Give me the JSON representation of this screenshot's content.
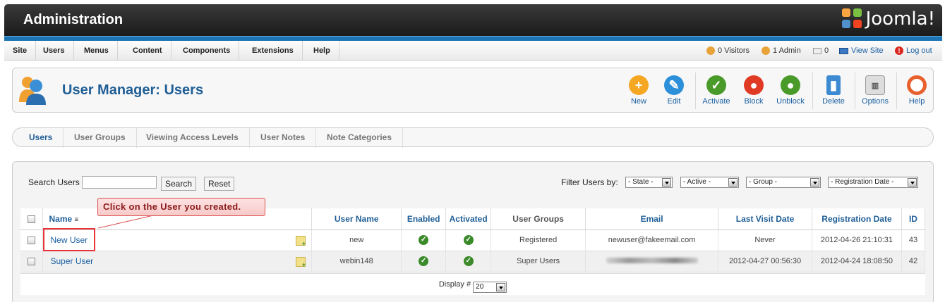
{
  "header": {
    "title": "Administration",
    "brand": "Joomla!"
  },
  "menubar": {
    "items": [
      "Site",
      "Users",
      "Menus",
      "Content",
      "Components",
      "Extensions",
      "Help"
    ],
    "status": {
      "visitors": "0 Visitors",
      "admins": "1 Admin",
      "messages": "0",
      "view_site": "View Site",
      "logout": "Log out"
    }
  },
  "toolbar": {
    "title": "User Manager: Users",
    "buttons": [
      "New",
      "Edit",
      "Activate",
      "Block",
      "Unblock",
      "Delete",
      "Options",
      "Help"
    ]
  },
  "tabs": [
    "Users",
    "User Groups",
    "Viewing Access Levels",
    "User Notes",
    "Note Categories"
  ],
  "search": {
    "label": "Search Users",
    "value": "",
    "search_btn": "Search",
    "reset_btn": "Reset"
  },
  "filters": {
    "label": "Filter Users by:",
    "state": "- State -",
    "active": "- Active -",
    "group": "- Group -",
    "registration": "- Registration Date -"
  },
  "table": {
    "columns": [
      "Name",
      "User Name",
      "Enabled",
      "Activated",
      "User Groups",
      "Email",
      "Last Visit Date",
      "Registration Date",
      "ID"
    ],
    "rows": [
      {
        "name": "New User",
        "username": "new",
        "group": "Registered",
        "email": "newuser@fakeemail.com",
        "last_visit": "Never",
        "registered": "2012-04-26 21:10:31",
        "id": "43"
      },
      {
        "name": "Super User",
        "username": "webin148",
        "group": "Super Users",
        "email": "",
        "last_visit": "2012-04-27 00:56:30",
        "registered": "2012-04-24 18:08:50",
        "id": "42"
      }
    ],
    "display_label": "Display #",
    "display_value": "20"
  },
  "callout": {
    "text": "Click on the User you created."
  },
  "colors": {
    "brand_blue": "#1f5e96",
    "strip": "#1c74b4",
    "callout_border": "#d9534f"
  }
}
